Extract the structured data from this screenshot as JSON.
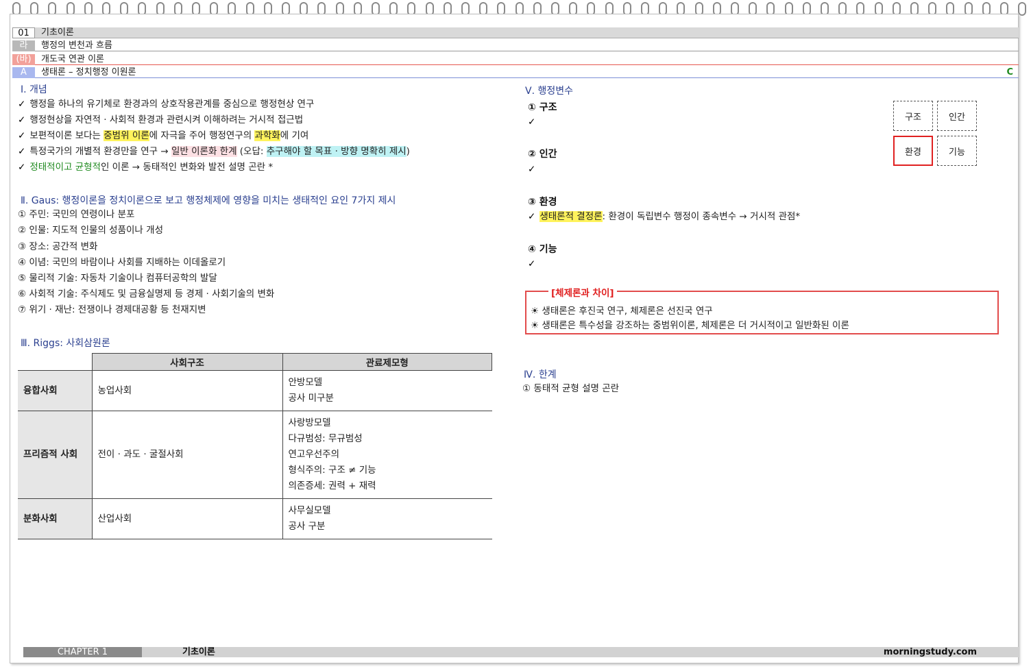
{
  "header": {
    "chapter_num": "01",
    "chapter_title": "기초이론",
    "sub1_num": "라",
    "sub1_title": "행정의 변천과 흐름",
    "sub2_num": "(바)",
    "sub2_title": "개도국 연관 이론",
    "sub3_num": "A",
    "sub3_title": "생태론 – 정치행정 이원론",
    "grade": "C"
  },
  "concept": {
    "title": "Ⅰ. 개념",
    "lines": [
      {
        "check": "✓",
        "t1": "행정을 하나의 유기체로 환경과의 상호작용관계를 중심으로 행정현상 연구"
      },
      {
        "check": "✓",
        "t1": "행정현상을 자연적 · 사회적 환경과 관련시켜 이해하려는 거시적 접근법"
      },
      {
        "check": "✓",
        "t1": "보편적이론 보다는 ",
        "h1": "중범위 이론",
        "t2": "에 자극을 주어 행정연구의 ",
        "h2": "과학화",
        "t3": "에 기여"
      },
      {
        "check": "✓",
        "t1": "특정국가의 개별적 환경만을 연구 → ",
        "h1": "일반 이론화 한계",
        "t2": " (오답: ",
        "h2": "추구해야 할 목표 · 방향 명확히 제시",
        "t3": ")"
      },
      {
        "check": "✓",
        "g1": "정태적이고 균형적",
        "t1": "인 이론 → 동태적인 변화와 발전 설명 곤란 *"
      }
    ]
  },
  "gaus": {
    "title": "Ⅱ. Gaus: 행정이론을 정치이론으로 보고 행정체제에 영향을 미치는 생태적인 요인 7가지 제시",
    "items": [
      "① 주민: 국민의 연령이나 분포",
      "② 인물: 지도적 인물의 성품이나 개성",
      "③ 장소: 공간적 변화",
      "④ 이념: 국민의 바람이나 사회를 지배하는 이데올로기",
      "⑤ 물리적 기술: 자동차 기술이나 컴퓨터공학의 발달",
      "⑥ 사회적 기술: 주식제도 및 금융실명제 등 경제 · 사회기술의 변화",
      "⑦ 위기 · 재난: 전쟁이나 경제대공황 등 천재지변"
    ]
  },
  "riggs": {
    "title": "Ⅲ. Riggs: 사회삼원론",
    "headers": [
      "",
      "사회구조",
      "관료제모형"
    ],
    "rows": [
      {
        "society": "융합사회",
        "structure": "농업사회",
        "model": [
          "안방모델",
          "공사 미구분"
        ]
      },
      {
        "society": "프리즘적 사회",
        "structure": "전이 · 과도 · 굴절사회",
        "model": [
          "사랑방모델",
          "다규범성: 무규범성",
          "연고우선주의",
          "형식주의: 구조 ≠ 기능",
          "의존증세: 권력 + 재력"
        ]
      },
      {
        "society": "분화사회",
        "structure": "산업사회",
        "model": [
          "사무실모델",
          "공사 구분"
        ]
      }
    ]
  },
  "variables": {
    "title": "Ⅴ. 행정변수",
    "items": [
      {
        "label": "① 구조",
        "check": "✓",
        "text": ""
      },
      {
        "label": "② 인간",
        "check": "✓",
        "text": ""
      },
      {
        "label": "③ 환경",
        "check": "✓",
        "hl": "생태론적 결정론",
        "text": ": 환경이 독립변수 행정이 종속변수 → 거시적 관점*"
      },
      {
        "label": "④ 기능",
        "check": "✓",
        "text": ""
      }
    ],
    "grid": [
      "구조",
      "인간",
      "환경",
      "기능"
    ],
    "selected": "환경"
  },
  "diff": {
    "title": "[체제론과 차이]",
    "lines": [
      "☀ 생태론은 후진국 연구, 체제론은 선진국 연구",
      "☀ 생태론은 특수성을 강조하는 중범위이론, 체제론은 더 거시적이고 일반화된 이론"
    ]
  },
  "limits": {
    "title": "Ⅳ. 한계",
    "items": [
      "① 동태적 균형 설명 곤란"
    ]
  },
  "footer": {
    "chapter": "CHAPTER 1",
    "title": "기초이론",
    "site": "morningstudy.com"
  }
}
